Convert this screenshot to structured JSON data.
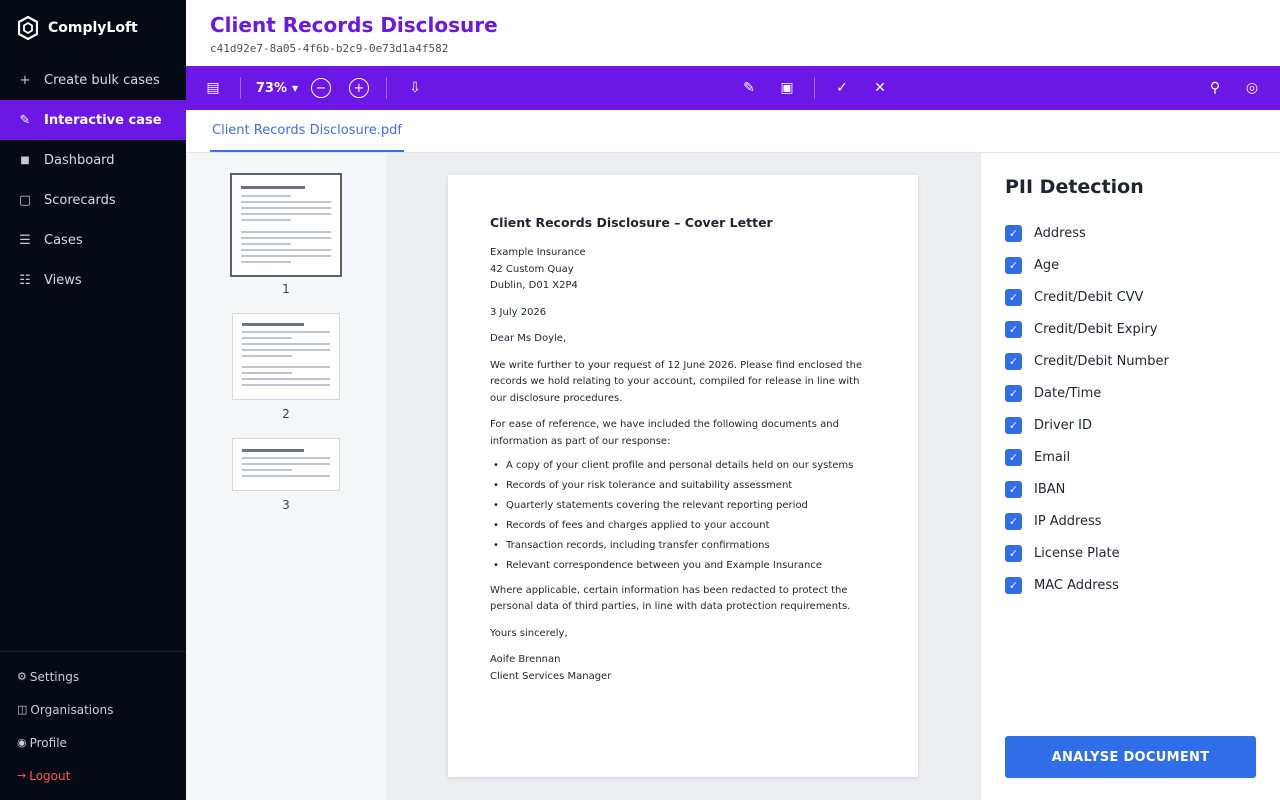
{
  "app": {
    "name": "ComplyLoft",
    "logo_icon": "hexagon-logo-icon"
  },
  "sidebar": {
    "items": [
      {
        "label": "Create bulk cases",
        "icon": "plus-icon",
        "glyph": "+",
        "active": false
      },
      {
        "label": "Interactive case",
        "icon": "pencil-icon",
        "glyph": "✎",
        "active": true
      },
      {
        "label": "Dashboard",
        "icon": "square-icon",
        "glyph": "■",
        "active": false
      },
      {
        "label": "Scorecards",
        "icon": "square-outline-icon",
        "glyph": "▢",
        "active": false
      },
      {
        "label": "Cases",
        "icon": "list-icon",
        "glyph": "☰",
        "active": false
      },
      {
        "label": "Views",
        "icon": "grid-list-icon",
        "glyph": "☷",
        "active": false
      }
    ],
    "bottom": [
      {
        "label": "Settings",
        "icon": "gear-icon",
        "glyph": "⚙"
      },
      {
        "label": "Organisations",
        "icon": "columns-icon",
        "glyph": "◫"
      },
      {
        "label": "Profile",
        "icon": "user-circle-icon",
        "glyph": "◉"
      },
      {
        "label": "Logout",
        "icon": "logout-arrow-icon",
        "glyph": "→"
      }
    ]
  },
  "header": {
    "title": "Client Records Disclosure",
    "case_id": "c41d92e7-8a05-4f6b-b2c9-0e73d1a4f582"
  },
  "toolbar": {
    "zoom": "73%",
    "icons": {
      "sidebar_toggle": "▤",
      "zoom_out": "−",
      "zoom_in": "+",
      "download": "⇩",
      "edit": "✎",
      "redact": "▣",
      "approve": "✓",
      "reject": "✕",
      "search": "⚲",
      "target": "◎"
    }
  },
  "file_tab": {
    "label": "Client Records Disclosure.pdf"
  },
  "thumbnails": {
    "pages": [
      "1",
      "2",
      "3"
    ],
    "selected": "1"
  },
  "document": {
    "heading": "Client Records Disclosure – Cover Letter",
    "address_lines": [
      "Example Insurance",
      "42 Custom Quay",
      "Dublin, D01 X2P4"
    ],
    "date": "3 July 2026",
    "salutation": "Dear Ms Doyle,",
    "para1": "We write further to your request of 12 June 2026. Please find enclosed the records we hold relating to your account, compiled for release in line with our disclosure procedures.",
    "para2": "For ease of reference, we have included the following documents and information as part of our response:",
    "bullets": [
      "A copy of your client profile and personal details held on our systems",
      "Records of your risk tolerance and suitability assessment",
      "Quarterly statements covering the relevant reporting period",
      "Records of fees and charges applied to your account",
      "Transaction records, including transfer confirmations",
      "Relevant correspondence between you and Example Insurance"
    ],
    "para3": "Where applicable, certain information has been redacted to protect the personal data of third parties, in line with data protection requirements.",
    "closing": "Yours sincerely,",
    "signer_name": "Aoife Brennan",
    "signer_title": "Client Services Manager"
  },
  "pii": {
    "title": "PII Detection",
    "items": [
      {
        "label": "Address",
        "checked": true
      },
      {
        "label": "Age",
        "checked": true
      },
      {
        "label": "Credit/Debit CVV",
        "checked": true
      },
      {
        "label": "Credit/Debit Expiry",
        "checked": true
      },
      {
        "label": "Credit/Debit Number",
        "checked": true
      },
      {
        "label": "Date/Time",
        "checked": true
      },
      {
        "label": "Driver ID",
        "checked": true
      },
      {
        "label": "Email",
        "checked": true
      },
      {
        "label": "IBAN",
        "checked": true
      },
      {
        "label": "IP Address",
        "checked": true
      },
      {
        "label": "License Plate",
        "checked": true
      },
      {
        "label": "MAC Address",
        "checked": true
      }
    ],
    "check_glyph": "✓",
    "analyse_label": "ANALYSE DOCUMENT"
  },
  "colors": {
    "brand_purple": "#6b17e6",
    "sidebar_bg": "#060a14",
    "primary_blue": "#2f6ee8",
    "logout_red": "#ff5a4e"
  }
}
